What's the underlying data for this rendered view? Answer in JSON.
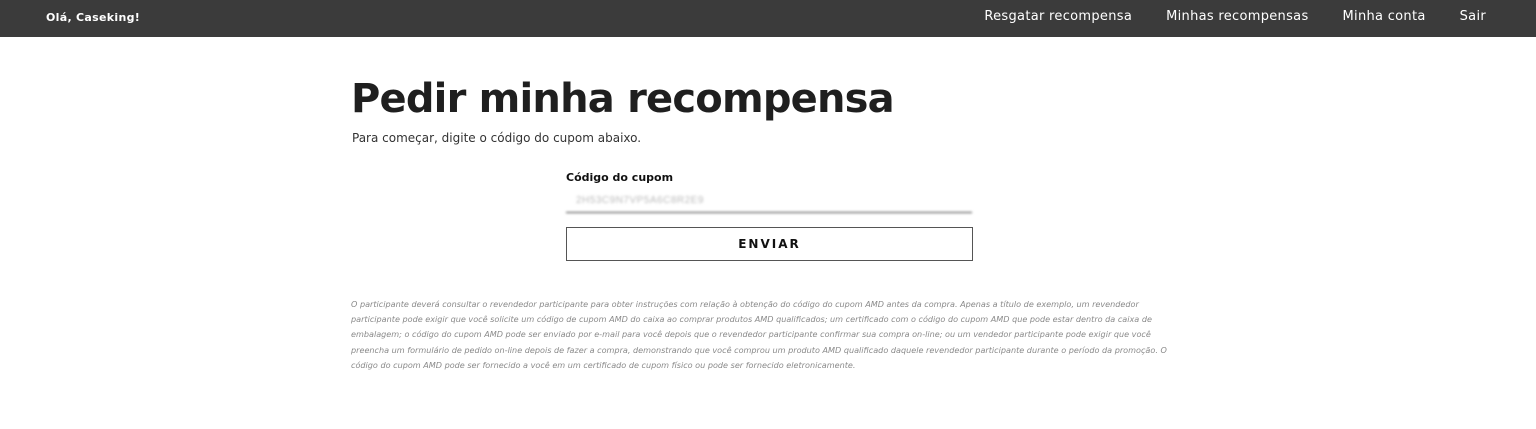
{
  "header": {
    "greeting": "Olá, Caseking!",
    "nav": [
      {
        "label": "Resgatar recompensa"
      },
      {
        "label": "Minhas recompensas"
      },
      {
        "label": "Minha conta"
      },
      {
        "label": "Sair"
      }
    ]
  },
  "main": {
    "title": "Pedir minha recompensa",
    "subtitle": "Para começar, digite o código do cupom abaixo.",
    "coupon": {
      "label": "Código do cupom",
      "value": "2H53C9N7VP5A6C8R2E9"
    },
    "submit_label": "ENVIAR",
    "disclaimer": "O participante deverá consultar o revendedor participante para obter instruções com relação à obtenção do código do cupom AMD antes da compra. Apenas a título de exemplo, um revendedor participante pode exigir que você solicite um código de cupom AMD do caixa ao comprar produtos AMD qualificados; um certificado com o código do cupom AMD que pode estar dentro da caixa de embalagem; o código do cupom AMD pode ser enviado por e-mail para você depois que o revendedor participante confirmar sua compra on-line; ou um vendedor participante pode exigir que você preencha um formulário de pedido on-line depois de fazer a compra, demonstrando que você comprou um produto AMD qualificado daquele revendedor participante durante o período da promoção. O código do cupom AMD pode ser fornecido a você em um certificado de cupom físico ou pode ser fornecido eletronicamente."
  },
  "colors": {
    "header_bg": "#3b3b3b",
    "header_text": "#ffffff",
    "disclaimer_text": "#8a8a8a"
  }
}
